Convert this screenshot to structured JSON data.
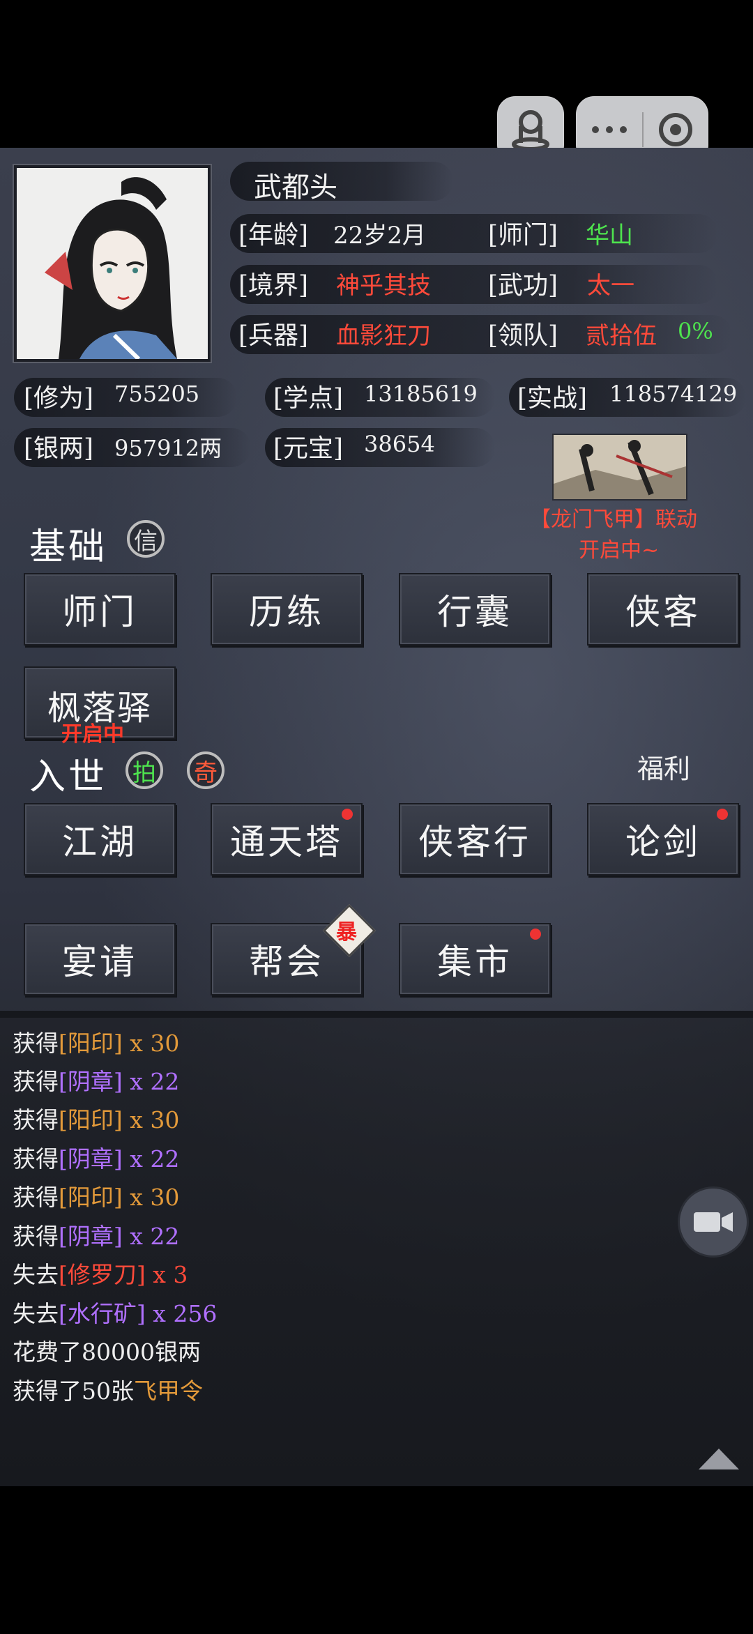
{
  "miniprogram": {
    "capsule_icons": [
      "person-pin-icon",
      "more-dots-icon",
      "close-target-icon"
    ]
  },
  "profile": {
    "name": "武都头",
    "age_label": "[年龄]",
    "age_value": "22岁2月",
    "school_label": "[师门]",
    "school_value": "华山",
    "realm_label": "[境界]",
    "realm_value": "神乎其技",
    "skill_label": "[武功]",
    "skill_value": "太一",
    "weapon_label": "[兵器]",
    "weapon_value": "血影狂刀",
    "team_label": "[领队]",
    "team_value": "贰拾伍",
    "team_percent": "0%"
  },
  "stats": {
    "cultivation_label": "[修为]",
    "cultivation_value": "755205",
    "study_label": "[学点]",
    "study_value": "13185619",
    "combat_label": "[实战]",
    "combat_value": "118574129",
    "silver_label": "[银两]",
    "silver_value": "957912两",
    "ingot_label": "[元宝]",
    "ingot_value": "38654"
  },
  "event": {
    "line1": "【龙门飞甲】联动",
    "line2": "开启中~"
  },
  "basic": {
    "title": "基础",
    "badge": "信",
    "buttons": [
      "师门",
      "历练",
      "行囊",
      "侠客"
    ],
    "extra_button": "枫落驿",
    "extra_button_status": "开启中"
  },
  "world": {
    "title": "入世",
    "badge_auction": "拍",
    "badge_rare": "奇",
    "welfare": "福利",
    "row1": [
      "江湖",
      "通天塔",
      "侠客行",
      "论剑"
    ],
    "row2": [
      "宴请",
      "帮会",
      "集市"
    ],
    "guild_badge": "暴"
  },
  "log": [
    {
      "prefix": "获得",
      "item": "[阳印]",
      "suffix": " x 30",
      "color": "orange"
    },
    {
      "prefix": "获得",
      "item": "[阴章]",
      "suffix": " x 22",
      "color": "purple"
    },
    {
      "prefix": "获得",
      "item": "[阳印]",
      "suffix": " x 30",
      "color": "orange"
    },
    {
      "prefix": "获得",
      "item": "[阴章]",
      "suffix": " x 22",
      "color": "purple"
    },
    {
      "prefix": "获得",
      "item": "[阳印]",
      "suffix": " x 30",
      "color": "orange"
    },
    {
      "prefix": "获得",
      "item": "[阴章]",
      "suffix": " x 22",
      "color": "purple"
    },
    {
      "prefix": "失去",
      "item": "[修罗刀]",
      "suffix": " x 3",
      "color": "red"
    },
    {
      "prefix": "失去",
      "item": "[水行矿]",
      "suffix": " x 256",
      "color": "purple"
    },
    {
      "prefix": "花费了80000银两",
      "item": "",
      "suffix": "",
      "color": "white"
    },
    {
      "prefix": "获得了50张",
      "item": "飞甲令",
      "suffix": "",
      "color": "orange"
    }
  ]
}
